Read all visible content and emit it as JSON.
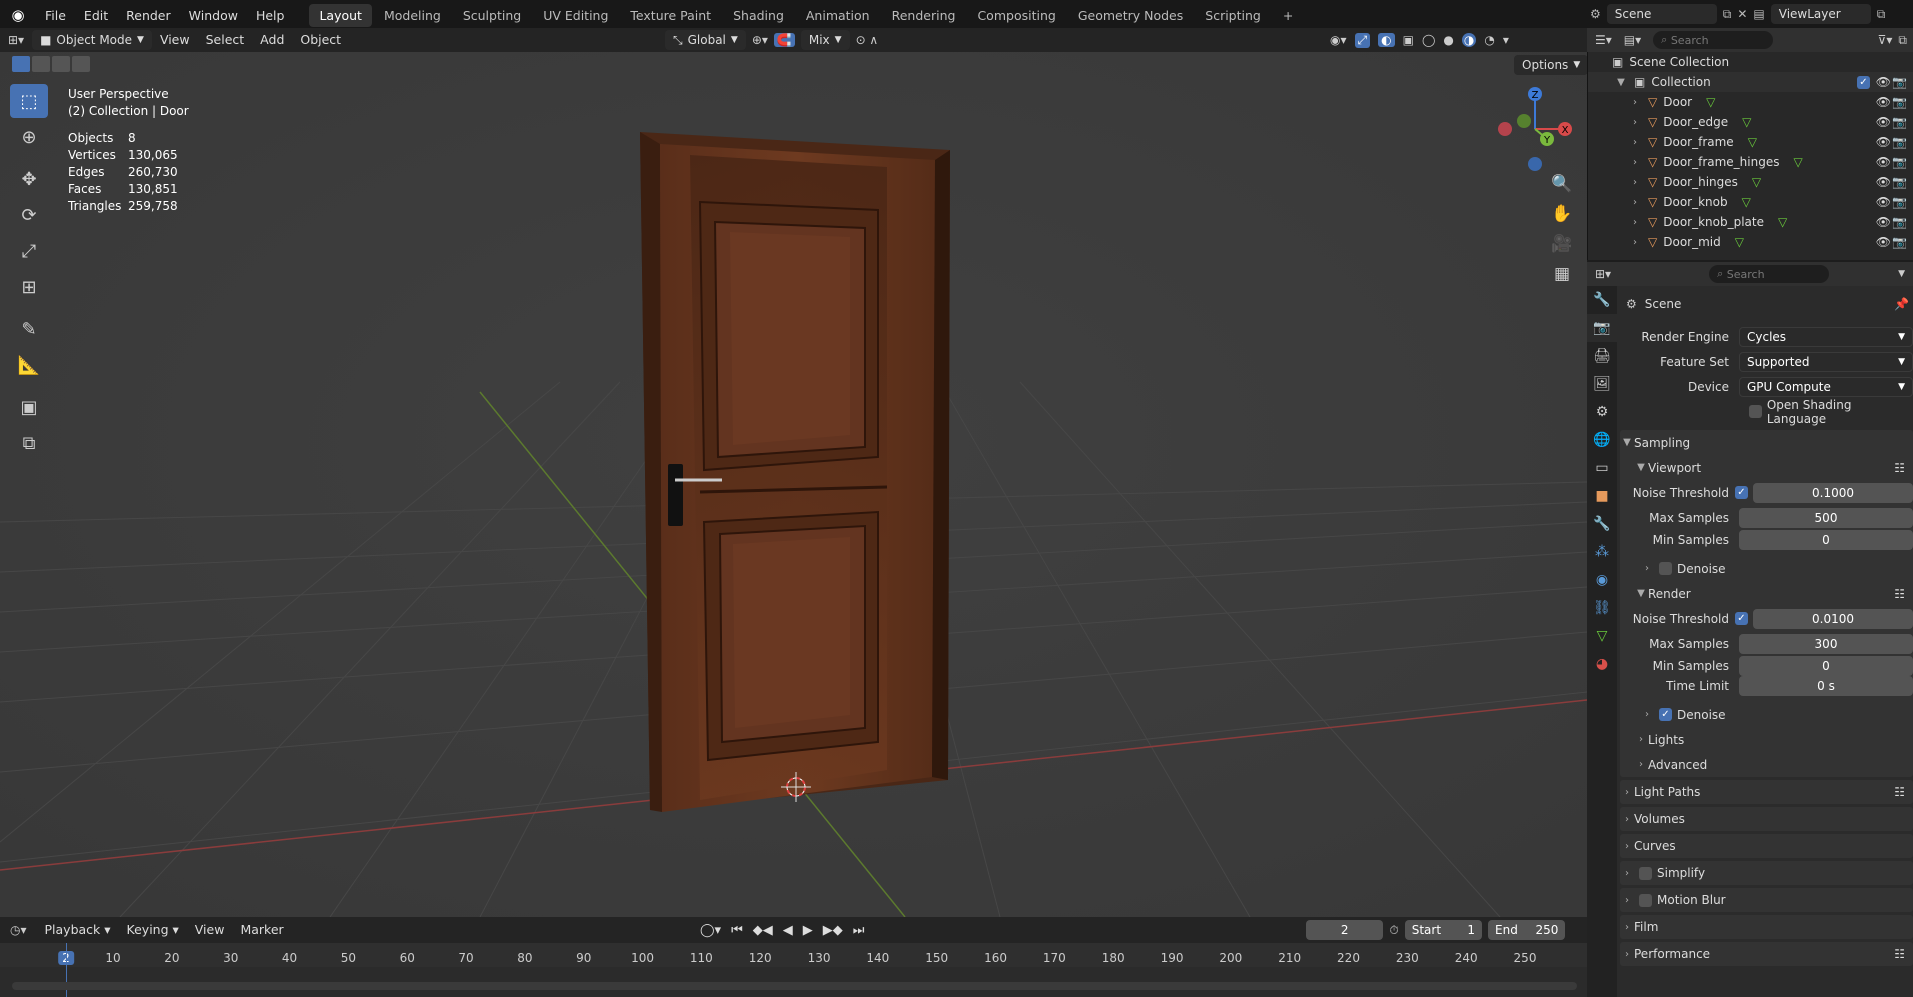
{
  "topbar": {
    "menus": [
      "File",
      "Edit",
      "Render",
      "Window",
      "Help"
    ],
    "workspaces": [
      "Layout",
      "Modeling",
      "Sculpting",
      "UV Editing",
      "Texture Paint",
      "Shading",
      "Animation",
      "Rendering",
      "Compositing",
      "Geometry Nodes",
      "Scripting"
    ],
    "active_workspace": "Layout",
    "scene": "Scene",
    "view_layer": "ViewLayer"
  },
  "header": {
    "mode": "Object Mode",
    "menus": [
      "View",
      "Select",
      "Add",
      "Object"
    ],
    "orientation": "Global",
    "snap": "Mix",
    "options": "Options"
  },
  "viewport": {
    "perspective": "User Perspective",
    "collection": "(2) Collection | Door",
    "stats": [
      {
        "label": "Objects",
        "value": "8"
      },
      {
        "label": "Vertices",
        "value": "130,065"
      },
      {
        "label": "Edges",
        "value": "260,730"
      },
      {
        "label": "Faces",
        "value": "130,851"
      },
      {
        "label": "Triangles",
        "value": "259,758"
      }
    ],
    "gizmo": {
      "x": "X",
      "y": "Y",
      "z": "Z"
    }
  },
  "outliner": {
    "search_placeholder": "Search",
    "root": "Scene Collection",
    "collection": "Collection",
    "items": [
      "Door",
      "Door_edge",
      "Door_frame",
      "Door_frame_hinges",
      "Door_hinges",
      "Door_knob",
      "Door_knob_plate",
      "Door_mid"
    ]
  },
  "properties": {
    "search_placeholder": "Search",
    "scene_label": "Scene",
    "render_engine": {
      "label": "Render Engine",
      "value": "Cycles"
    },
    "feature_set": {
      "label": "Feature Set",
      "value": "Supported"
    },
    "device": {
      "label": "Device",
      "value": "GPU Compute"
    },
    "osl": "Open Shading Language",
    "sampling": "Sampling",
    "viewport": {
      "title": "Viewport",
      "noise_threshold_label": "Noise Threshold",
      "noise_threshold": "0.1000",
      "max_samples_label": "Max Samples",
      "max_samples": "500",
      "min_samples_label": "Min Samples",
      "min_samples": "0",
      "denoise": "Denoise"
    },
    "render": {
      "title": "Render",
      "noise_threshold_label": "Noise Threshold",
      "noise_threshold": "0.0100",
      "max_samples_label": "Max Samples",
      "max_samples": "300",
      "min_samples_label": "Min Samples",
      "min_samples": "0",
      "time_limit_label": "Time Limit",
      "time_limit": "0 s",
      "denoise": "Denoise"
    },
    "lights": "Lights",
    "advanced": "Advanced",
    "sections": [
      "Light Paths",
      "Volumes",
      "Curves",
      "Simplify",
      "Motion Blur",
      "Film",
      "Performance"
    ]
  },
  "timeline": {
    "menus": [
      "Playback",
      "Keying",
      "View",
      "Marker"
    ],
    "current_frame": "2",
    "start_label": "Start",
    "start": "1",
    "end_label": "End",
    "end": "250",
    "ticks": [
      "2",
      "10",
      "20",
      "30",
      "40",
      "50",
      "60",
      "70",
      "80",
      "90",
      "100",
      "110",
      "120",
      "130",
      "140",
      "150",
      "160",
      "170",
      "180",
      "190",
      "200",
      "210",
      "220",
      "230",
      "240",
      "250"
    ]
  }
}
